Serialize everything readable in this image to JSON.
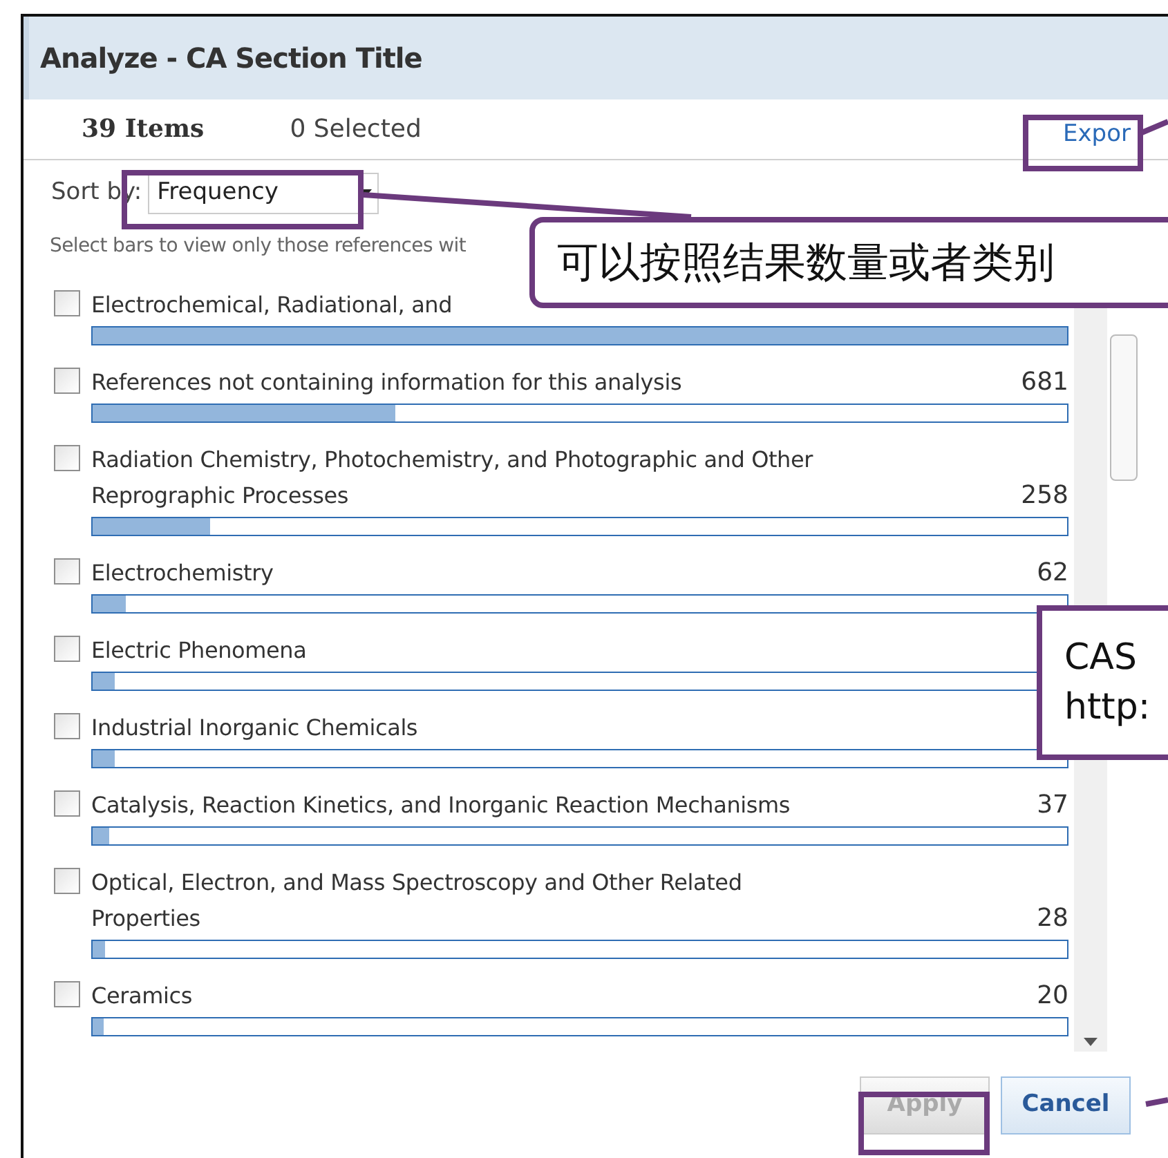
{
  "dialog": {
    "title": "Analyze - CA Section Title",
    "items_count": "39 Items",
    "selected_count": "0 Selected",
    "export_link": "Expor",
    "sort": {
      "label": "Sort by:",
      "value": "Frequency"
    },
    "hint": "Select bars to view only those references wit",
    "categories": [
      {
        "label": "Electrochemical, Radiational, and",
        "level": 1,
        "checked": false
      },
      {
        "label": "References not containing information for this analysis",
        "count": "681",
        "level": 0.31,
        "checked": false
      },
      {
        "label": "Radiation Chemistry, Photochemistry, and Photographic and Other Reprographic Processes",
        "count": "258",
        "level": 0.12,
        "checked": false
      },
      {
        "label": "Electrochemistry",
        "count": "62",
        "level": 0.034,
        "checked": false
      },
      {
        "label": "Electric Phenomena",
        "level": 0.022,
        "checked": false
      },
      {
        "label": "Industrial Inorganic Chemicals",
        "level": 0.022,
        "checked": false
      },
      {
        "label": "Catalysis, Reaction Kinetics, and Inorganic Reaction Mechanisms",
        "count": "37",
        "level": 0.017,
        "checked": false
      },
      {
        "label": "Optical, Electron, and Mass Spectroscopy and Other Related Properties",
        "count": "28",
        "level": 0.013,
        "checked": false
      },
      {
        "label": "Ceramics",
        "count": "20",
        "level": 0.009,
        "checked": false
      }
    ],
    "buttons": [
      {
        "label": "Apply",
        "disabled": true
      },
      {
        "label": "Cancel",
        "disabled": false
      }
    ]
  },
  "annotations": {
    "sort_callout": "可以按照结果数量或者类别",
    "cas_callout": [
      "CAS",
      "http:"
    ]
  }
}
